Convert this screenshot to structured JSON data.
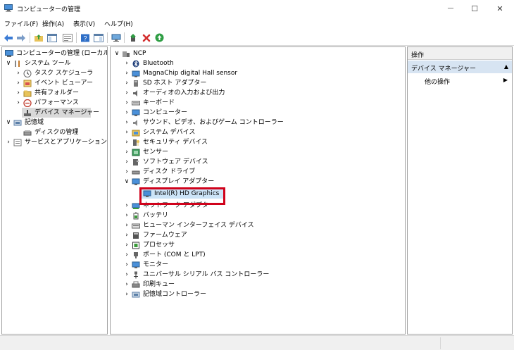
{
  "window": {
    "title": "コンピューターの管理",
    "controls": {
      "minimize": "—",
      "maximize": "☐",
      "close": "✕"
    }
  },
  "menubar": {
    "items": [
      "ファイル(F)",
      "操作(A)",
      "表示(V)",
      "ヘルプ(H)"
    ]
  },
  "toolbar": {
    "icons": [
      "back-arrow-icon",
      "forward-arrow-icon",
      "up-folder-icon",
      "show-hide-tree-icon",
      "properties-icon",
      "help-icon",
      "show-hide-action-pane-icon",
      "computer-scan-icon",
      "update-driver-icon",
      "uninstall-x-icon",
      "enable-device-icon"
    ]
  },
  "left_tree": {
    "items": [
      {
        "label": "コンピューターの管理 (ローカル)",
        "icon": "computer-management-icon",
        "expander": ""
      },
      {
        "label": "システム ツール",
        "icon": "tools-icon",
        "expander": "∨"
      },
      {
        "label": "タスク スケジューラ",
        "icon": "clock-icon",
        "expander": "›"
      },
      {
        "label": "イベント ビューアー",
        "icon": "event-viewer-icon",
        "expander": "›"
      },
      {
        "label": "共有フォルダー",
        "icon": "shared-folder-icon",
        "expander": "›"
      },
      {
        "label": "パフォーマンス",
        "icon": "performance-icon",
        "expander": "›"
      },
      {
        "label": "デバイス マネージャー",
        "icon": "device-manager-icon",
        "expander": ""
      },
      {
        "label": "記憶域",
        "icon": "storage-icon",
        "expander": "∨"
      },
      {
        "label": "ディスクの管理",
        "icon": "disk-management-icon",
        "expander": ""
      },
      {
        "label": "サービスとアプリケーション",
        "icon": "services-icon",
        "expander": "›"
      }
    ]
  },
  "device_tree": {
    "root": {
      "label": "NCP",
      "icon": "computer-icon",
      "expander": "∨"
    },
    "items": [
      {
        "label": "Bluetooth",
        "icon": "bluetooth-icon",
        "expander": "›"
      },
      {
        "label": "MagnaChip digital Hall sensor",
        "icon": "sensor-icon",
        "expander": "›"
      },
      {
        "label": "SD ホスト アダプター",
        "icon": "sd-host-icon",
        "expander": "›"
      },
      {
        "label": "オーディオの入力および出力",
        "icon": "speaker-icon",
        "expander": "›"
      },
      {
        "label": "キーボード",
        "icon": "keyboard-icon",
        "expander": "›"
      },
      {
        "label": "コンピューター",
        "icon": "monitor-icon",
        "expander": "›"
      },
      {
        "label": "サウンド、ビデオ、およびゲーム コントローラー",
        "icon": "sound-icon",
        "expander": "›"
      },
      {
        "label": "システム デバイス",
        "icon": "system-device-icon",
        "expander": "›"
      },
      {
        "label": "セキュリティ デバイス",
        "icon": "security-device-icon",
        "expander": "›"
      },
      {
        "label": "センサー",
        "icon": "sensor-icon",
        "expander": "›"
      },
      {
        "label": "ソフトウェア デバイス",
        "icon": "software-device-icon",
        "expander": "›"
      },
      {
        "label": "ディスク ドライブ",
        "icon": "disk-drive-icon",
        "expander": "›"
      },
      {
        "label": "ディスプレイ アダプター",
        "icon": "display-adapter-icon",
        "expander": "∨"
      },
      {
        "label": "ネットワーク アダプター",
        "icon": "network-adapter-icon",
        "expander": "›"
      },
      {
        "label": "バッテリ",
        "icon": "battery-icon",
        "expander": "›"
      },
      {
        "label": "ヒューマン インターフェイス デバイス",
        "icon": "hid-icon",
        "expander": "›"
      },
      {
        "label": "ファームウェア",
        "icon": "firmware-icon",
        "expander": "›"
      },
      {
        "label": "プロセッサ",
        "icon": "processor-icon",
        "expander": "›"
      },
      {
        "label": "ポート (COM と LPT)",
        "icon": "port-icon",
        "expander": "›"
      },
      {
        "label": "モニター",
        "icon": "monitor-icon",
        "expander": "›"
      },
      {
        "label": "ユニバーサル シリアル バス コントローラー",
        "icon": "usb-icon",
        "expander": "›"
      },
      {
        "label": "印刷キュー",
        "icon": "printer-icon",
        "expander": "›"
      },
      {
        "label": "記憶域コントローラー",
        "icon": "storage-controller-icon",
        "expander": "›"
      }
    ],
    "child": {
      "label": "Intel(R) HD Graphics",
      "icon": "display-adapter-icon"
    }
  },
  "actions_pane": {
    "header": "操作",
    "section": "デバイス マネージャー",
    "section_arrow": "▲",
    "item": "他の操作",
    "item_arrow": "▶"
  },
  "colors": {
    "highlight_box": "#d0021b",
    "selection": "#cce4f7",
    "section_bg": "#d7e4f2"
  }
}
